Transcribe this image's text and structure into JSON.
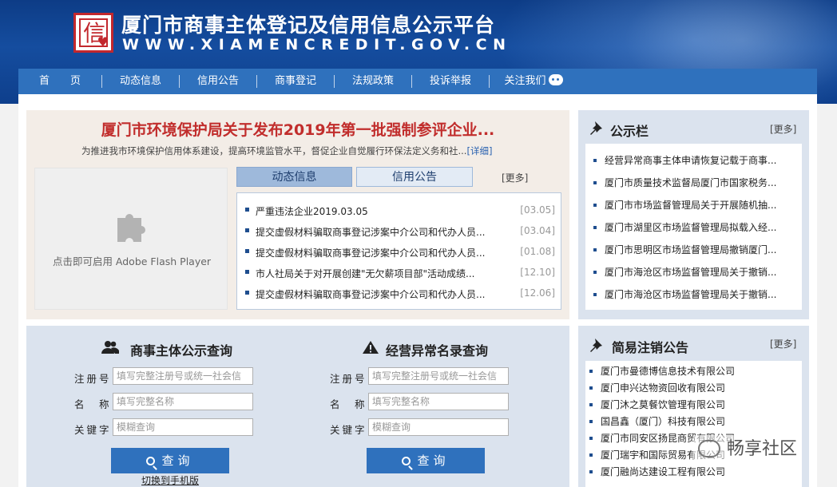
{
  "header": {
    "title": "厦门市商事主体登记及信用信息公示平台",
    "url": "WWW.XIAMENCREDIT.GOV.CN",
    "logo_char": "信"
  },
  "nav": {
    "items": [
      {
        "label": "首　　页"
      },
      {
        "label": "动态信息"
      },
      {
        "label": "信用公告"
      },
      {
        "label": "商事登记"
      },
      {
        "label": "法规政策"
      },
      {
        "label": "投诉举报"
      },
      {
        "label": "关注我们"
      }
    ]
  },
  "headline": {
    "title": "厦门市环境保护局关于发布2019年第一批强制参评企业...",
    "summary": "为推进我市环境保护信用体系建设，提高环境监管水平，督促企业自觉履行环保法定义务和社...",
    "detail_link": "[详细]"
  },
  "flash": {
    "text": "点击即可启用 Adobe Flash Player"
  },
  "news": {
    "tabs": [
      {
        "label": "动态信息"
      },
      {
        "label": "信用公告"
      }
    ],
    "more": "[更多]",
    "items": [
      {
        "title": "严重违法企业2019.03.05",
        "date": "[03.05]"
      },
      {
        "title": "提交虚假材料骗取商事登记涉案中介公司和代办人员...",
        "date": "[03.04]"
      },
      {
        "title": "提交虚假材料骗取商事登记涉案中介公司和代办人员...",
        "date": "[01.08]"
      },
      {
        "title": "市人社局关于对开展创建\"无欠薪项目部\"活动成绩...",
        "date": "[12.10]"
      },
      {
        "title": "提交虚假材料骗取商事登记涉案中介公司和代办人员...",
        "date": "[12.06]"
      }
    ]
  },
  "bulletin": {
    "title": "公示栏",
    "more": "[更多]",
    "items": [
      "经营异常商事主体申请恢复记载于商事...",
      "厦门市质量技术监督局厦门市国家税务...",
      "厦门市市场监督管理局关于开展随机抽...",
      "厦门市湖里区市场监督管理局拟载入经...",
      "厦门市思明区市场监督管理局撤销厦门...",
      "厦门市海沧区市场监督管理局关于撤销...",
      "厦门市海沧区市场监督管理局关于撤销..."
    ]
  },
  "cancellation": {
    "title": "简易注销公告",
    "more": "[更多]",
    "items": [
      "厦门市曼德博信息技术有限公司",
      "厦门申兴达物资回收有限公司",
      "厦门沐之莫餐饮管理有限公司",
      "国昌鑫（厦门）科技有限公司",
      "厦门市同安区扬昆商贸有限公司",
      "厦门瑞宇和国际贸易有限公司",
      "厦门融尚达建设工程有限公司"
    ]
  },
  "query_main": {
    "title": "商事主体公示查询",
    "labels": {
      "reg_no": "注册号",
      "name": "名　称",
      "keyword": "关键字"
    },
    "placeholders": {
      "reg_no": "填写完整注册号或统一社会信",
      "name": "填写完整名称",
      "keyword": "模糊查询"
    },
    "button": "查询",
    "mobile_link": "切换到手机版"
  },
  "query_abnormal": {
    "title": "经营异常名录查询",
    "labels": {
      "reg_no": "注册号",
      "name": "名　称",
      "keyword": "关键字"
    },
    "placeholders": {
      "reg_no": "填写完整注册号或统一社会信",
      "name": "填写完整名称",
      "keyword": "模糊查询"
    },
    "button": "查询"
  },
  "watermark": {
    "text": "畅享社区"
  },
  "colors": {
    "header_blue": "#154d9f",
    "nav_blue": "#2f71bd",
    "headline_red": "#c12d2c",
    "panel_bg": "#dbe3ee"
  }
}
